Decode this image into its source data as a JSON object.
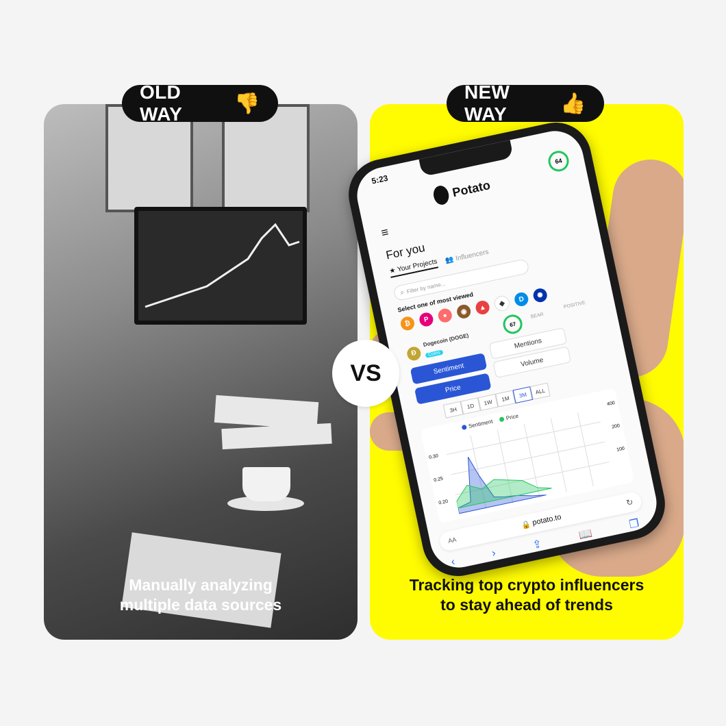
{
  "old_way": {
    "label": "OLD WAY",
    "emoji": "👎",
    "caption_line1": "Manually analyzing",
    "caption_line2": "multiple data sources"
  },
  "new_way": {
    "label": "NEW WAY",
    "emoji": "👍",
    "caption_line1": "Tracking top crypto influencers",
    "caption_line2": "to stay ahead of trends"
  },
  "vs_label": "VS",
  "colors": {
    "new_panel_bg": "#fffb00",
    "pill_bg": "#101010",
    "accent_blue": "#2a56d6",
    "accent_green": "#22c55e"
  },
  "phone": {
    "time": "5:23",
    "app_name": "Potato",
    "score_badge": "64",
    "page_title": "For you",
    "tabs": [
      "Your Projects",
      "Influencers"
    ],
    "filter_placeholder": "Filter by name...",
    "select_label": "Select one of most viewed",
    "coin_icons": [
      "bitcoin-icon",
      "polkadot-icon",
      "pancake-icon",
      "ape-icon",
      "avalanche-icon",
      "ethereum-icon",
      "dash-icon",
      "cardano-icon"
    ],
    "project_name": "Dogecoin (DOGE)",
    "project_tag": "Coins",
    "project_score": "67",
    "bear_label": "BEAR",
    "positive_label": "POSITIVE",
    "metric_buttons": [
      "Sentiment",
      "Mentions",
      "Volume",
      "Price"
    ],
    "timeframes": [
      "3H",
      "1D",
      "1W",
      "1M",
      "3M",
      "ALL"
    ],
    "legend": [
      "Sentiment",
      "Price"
    ],
    "left_ticks": [
      "0.30",
      "0.25",
      "0.20"
    ],
    "right_ticks": [
      "400",
      "200",
      "100"
    ],
    "url": "potato.to",
    "font_toggle": "AA"
  }
}
